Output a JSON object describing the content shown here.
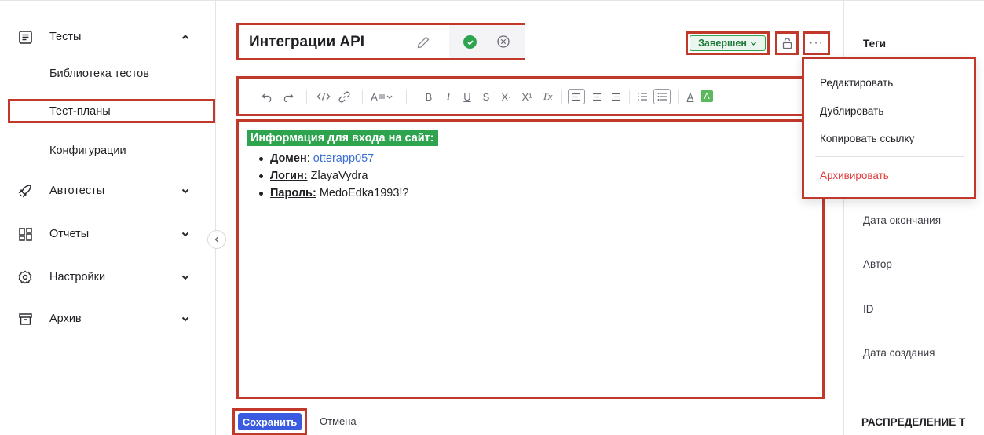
{
  "sidebar": {
    "tests": {
      "label": "Тесты",
      "icon": "document-list-icon"
    },
    "tests_sub": [
      {
        "label": "Библиотека тестов"
      },
      {
        "label": "Тест-планы"
      },
      {
        "label": "Конфигурации"
      }
    ],
    "autotests": {
      "label": "Автотесты",
      "icon": "rocket-icon"
    },
    "reports": {
      "label": "Отчеты",
      "icon": "dashboard-icon"
    },
    "settings": {
      "label": "Настройки",
      "icon": "gear-icon"
    },
    "archive": {
      "label": "Архив",
      "icon": "archive-box-icon"
    }
  },
  "header": {
    "title": "Интеграции API",
    "status": "Завершен"
  },
  "editor": {
    "heading": "Информация для входа на сайт:",
    "items": [
      {
        "key": "Домен",
        "sep": ": ",
        "value": "otterapp057"
      },
      {
        "key": "Логин:",
        "sep": " ",
        "value": "ZlayaVydra"
      },
      {
        "key": "Пароль:",
        "sep": " ",
        "value": "MedoEdka1993!?"
      }
    ]
  },
  "toolbar": {
    "font_size_label": "A",
    "bold": "B",
    "italic": "I",
    "underline": "U",
    "strike": "S",
    "subscript": "X₁",
    "superscript": "X¹",
    "clear_format": "Tx",
    "text_color": "A",
    "highlight": "A"
  },
  "footer": {
    "save": "Сохранить",
    "cancel": "Отмена"
  },
  "right_panel": {
    "tags": "Теги",
    "end_date": "Дата окончания",
    "author": "Автор",
    "id": "ID",
    "created": "Дата создания",
    "distribution": "РАСПРЕДЕЛЕНИЕ Т"
  },
  "menu": {
    "items": [
      "Редактировать",
      "Дублировать",
      "Копировать ссылку"
    ],
    "archive": "Архивировать"
  },
  "colors": {
    "accent_red": "#c0392b",
    "success_green": "#2ea44f",
    "primary_blue": "#3a5be0",
    "danger": "#e03b3b"
  }
}
